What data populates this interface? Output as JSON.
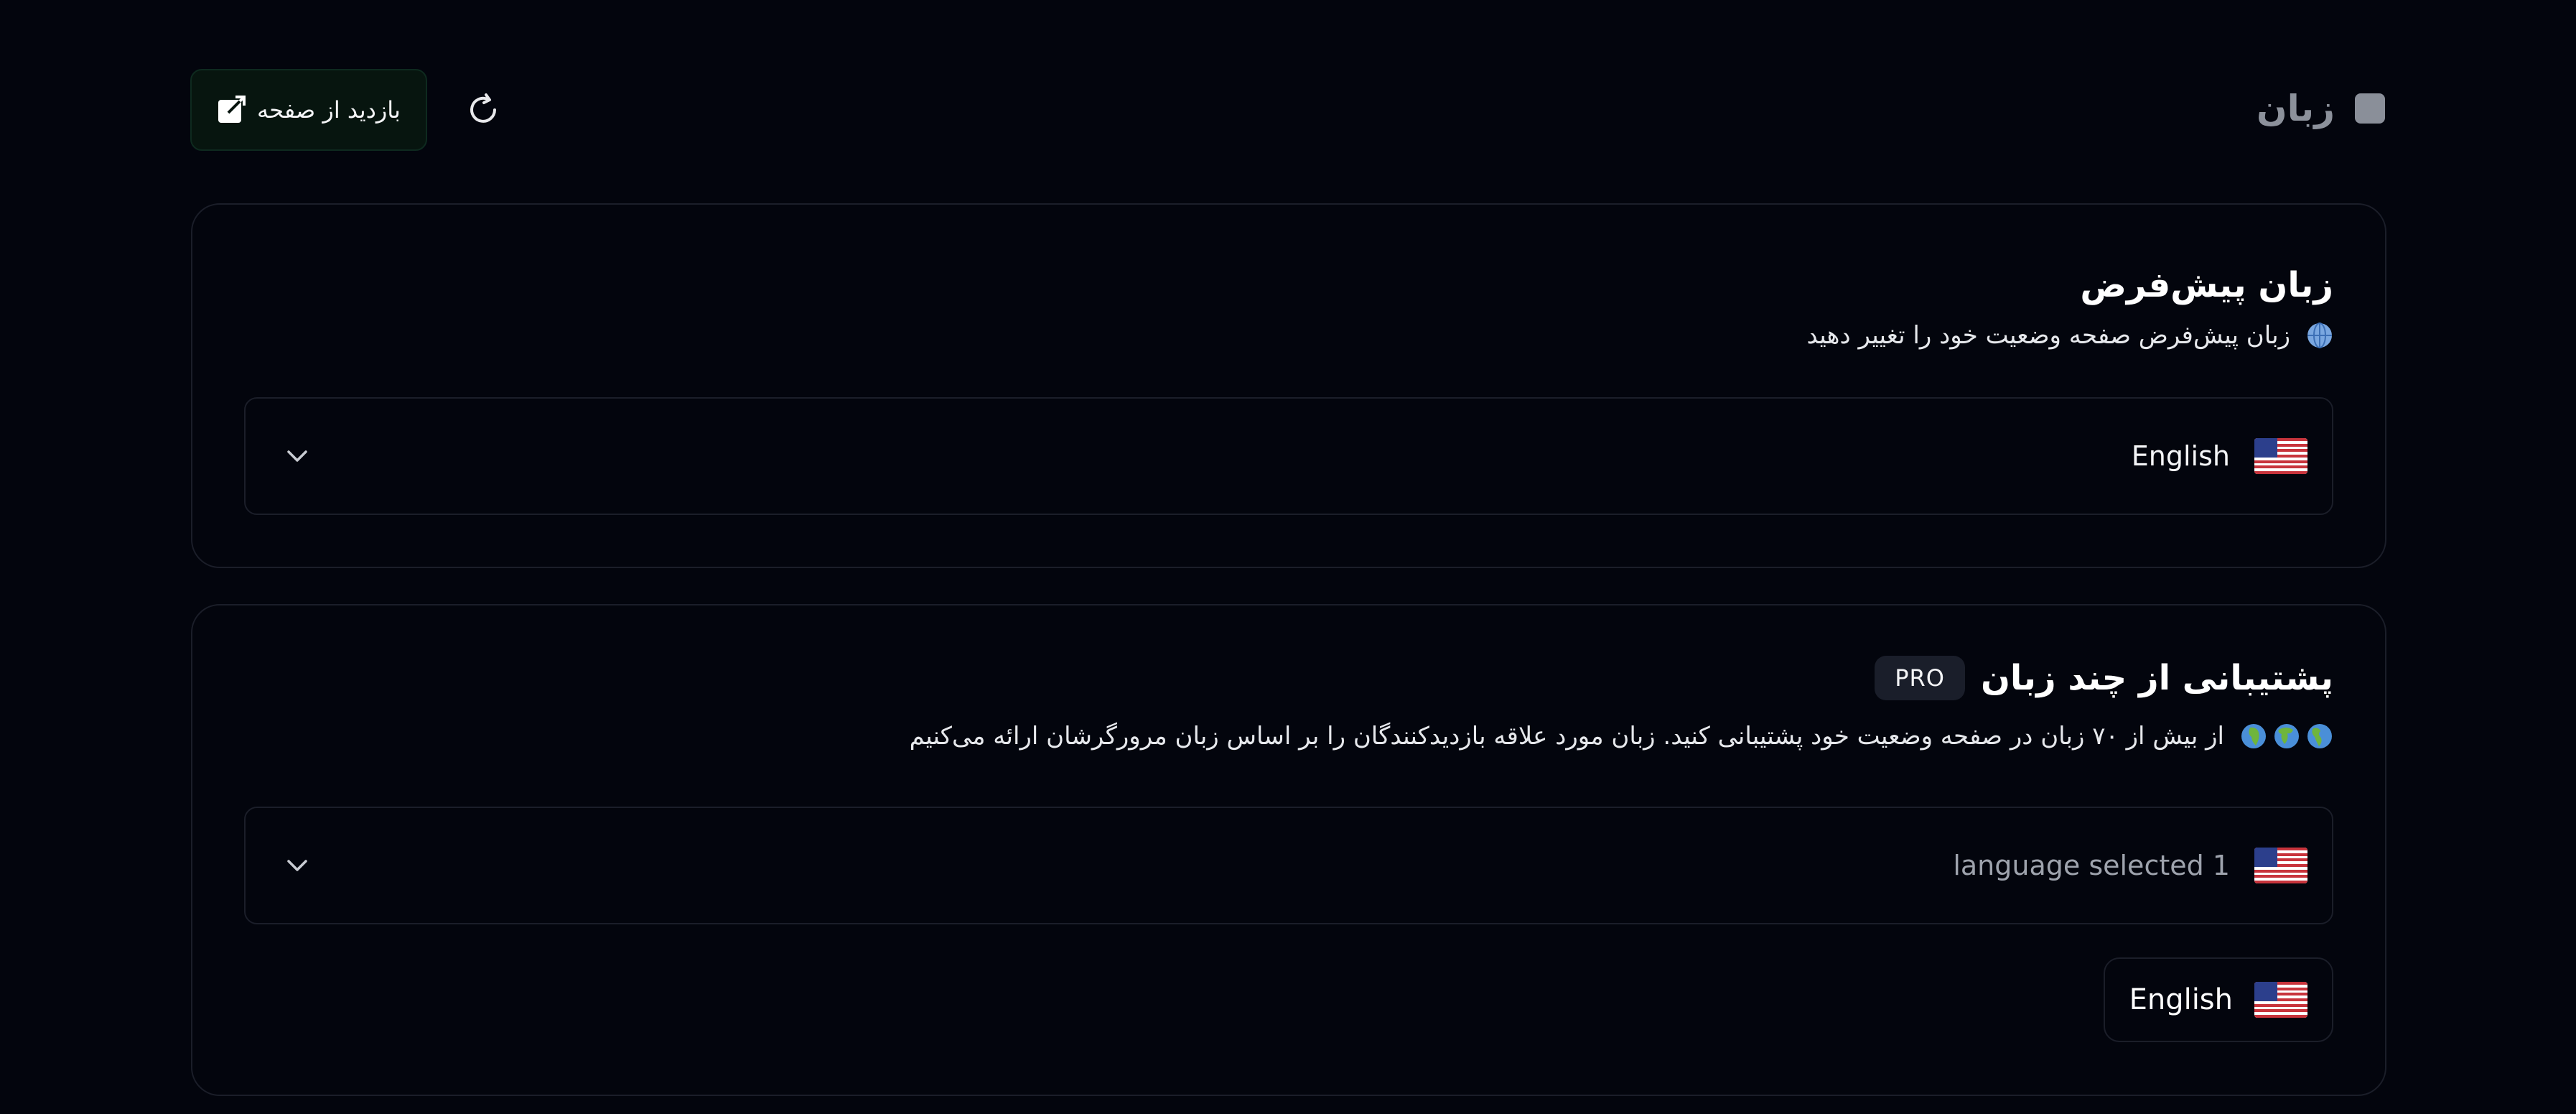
{
  "header": {
    "title": "زبان",
    "visit_button_label": "بازدید از صفحه"
  },
  "default_language": {
    "title": "زبان پیش‌فرض",
    "description": "زبان پیش‌فرض صفحه وضعیت خود را تغییر دهید",
    "selected": "English",
    "flag_icon": "us-flag-icon"
  },
  "multi_language": {
    "title": "پشتیبانی از چند زبان",
    "badge": "PRO",
    "description": "از بیش از ۷۰ زبان در صفحه وضعیت خود پشتیبانی کنید. زبان مورد علاقه بازدیدکنندگان را بر اساس زبان مرورگرشان ارائه می‌کنیم",
    "select_summary": "language selected 1",
    "selected_chips": [
      "English"
    ]
  },
  "colors": {
    "background": "#03050d",
    "card_border": "#1b1e29",
    "visit_button_bg": "#07150f"
  }
}
